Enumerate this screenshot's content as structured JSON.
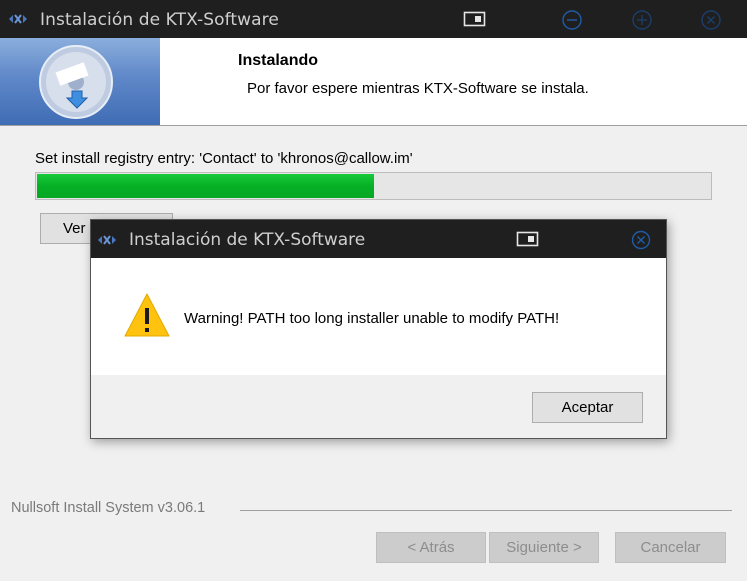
{
  "window": {
    "title": "Instalación de KTX-Software"
  },
  "header": {
    "heading": "Instalando",
    "subheading": "Por favor espere mientras KTX-Software se instala."
  },
  "status_text": "Set install registry entry: 'Contact' to 'khronos@callow.im'",
  "progress": {
    "value_percent": 50,
    "fill_color": "#06b025"
  },
  "details_button": "Ver detalles",
  "branding": "Nullsoft Install System v3.06.1",
  "buttons": {
    "back": "< Atrás",
    "next": "Siguiente >",
    "cancel": "Cancelar"
  },
  "dialog": {
    "title": "Instalación de KTX-Software",
    "message": "Warning! PATH too long installer unable to modify PATH!",
    "ok": "Aceptar",
    "icon": "warning-icon"
  },
  "colors": {
    "titlebar": "#1f1f1f",
    "titlebar_icon": "#1f5ca8",
    "progress": "#06b025",
    "warning": "#ffc20e"
  }
}
